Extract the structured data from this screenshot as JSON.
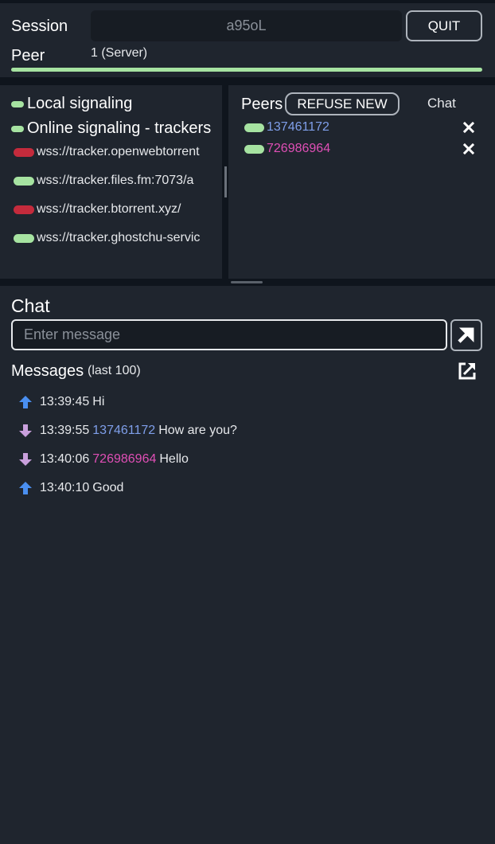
{
  "colors": {
    "peer1": "#7f9fea",
    "peer2": "#e04fb6",
    "on": "#a6e3a1",
    "off": "#c42b3c",
    "sent": "#4a8ff0",
    "received": "#c9a0dc"
  },
  "session": {
    "label": "Session",
    "value": "a95oL",
    "quit_label": "QUIT"
  },
  "peer": {
    "label": "Peer",
    "count_text": "1 (Server)",
    "progress": 1.0
  },
  "signaling": {
    "local": {
      "label": "Local signaling",
      "status": "on"
    },
    "online": {
      "label": "Online signaling - trackers",
      "status": "on"
    },
    "trackers": [
      {
        "url": "wss://tracker.openwebtorrent",
        "status": "off"
      },
      {
        "url": "wss://tracker.files.fm:7073/a",
        "status": "on"
      },
      {
        "url": "wss://tracker.btorrent.xyz/",
        "status": "off"
      },
      {
        "url": "wss://tracker.ghostchu-servic",
        "status": "on"
      }
    ]
  },
  "peers": {
    "title": "Peers",
    "refuse_label": "REFUSE NEW",
    "chat_header": "Chat",
    "list": [
      {
        "id": "137461172",
        "color": "#7f9fea",
        "status": "on"
      },
      {
        "id": "726986964",
        "color": "#e04fb6",
        "status": "on"
      }
    ]
  },
  "chat": {
    "title": "Chat",
    "input_placeholder": "Enter message",
    "input_value": "",
    "messages_title": "Messages",
    "messages_sub": "(last 100)",
    "messages": [
      {
        "dir": "sent",
        "time": "13:39:45",
        "from": "",
        "from_color": "",
        "text": "Hi"
      },
      {
        "dir": "received",
        "time": "13:39:55",
        "from": "137461172",
        "from_color": "#7f9fea",
        "text": "How are you?"
      },
      {
        "dir": "received",
        "time": "13:40:06",
        "from": "726986964",
        "from_color": "#e04fb6",
        "text": "Hello"
      },
      {
        "dir": "sent",
        "time": "13:40:10",
        "from": "",
        "from_color": "",
        "text": "Good"
      }
    ]
  }
}
